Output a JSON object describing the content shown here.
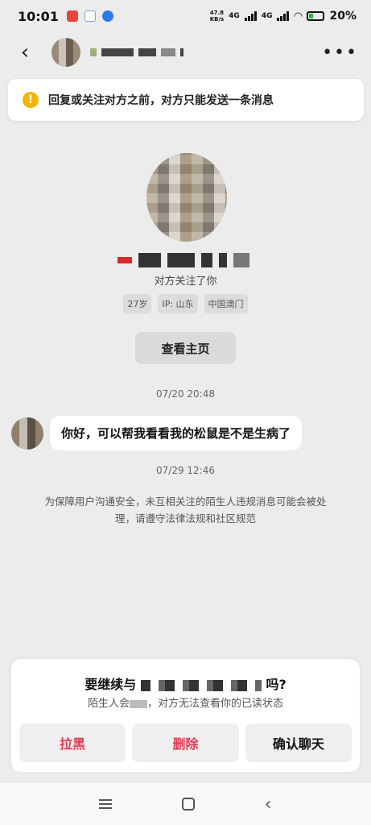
{
  "status_bar": {
    "time": "10:01",
    "net_speed_top": "47.8",
    "net_speed_unit": "KB/s",
    "network1": "4G",
    "network2": "4G",
    "battery": "20%"
  },
  "header": {
    "back_icon": "chevron-left-icon",
    "more_icon": "more-dots-icon"
  },
  "notice": {
    "text": "回复或关注对方之前，对方只能发送一条消息",
    "icon_color": "#f5b400"
  },
  "profile": {
    "follow_text": "对方关注了你",
    "tags": [
      "27岁",
      "IP: 山东",
      "中国澳门"
    ],
    "home_button": "查看主页"
  },
  "messages": [
    {
      "timestamp": "07/20 20:48",
      "text": "你好，可以帮我看看我的松鼠是不是生病了"
    }
  ],
  "timestamp2": "07/29 12:46",
  "safety_notice": "为保障用户沟通安全，未互相关注的陌生人违规消息可能会被处理，请遵守法律法规和社区规范",
  "sheet": {
    "title_prefix": "要继续与",
    "title_suffix": "吗?",
    "subtitle_prefix": "陌生人会",
    "subtitle_suffix": "，对方无法查看你的已读状态",
    "buttons": {
      "block": "拉黑",
      "delete": "删除",
      "confirm": "确认聊天"
    },
    "accent_color": "#e23a55"
  }
}
